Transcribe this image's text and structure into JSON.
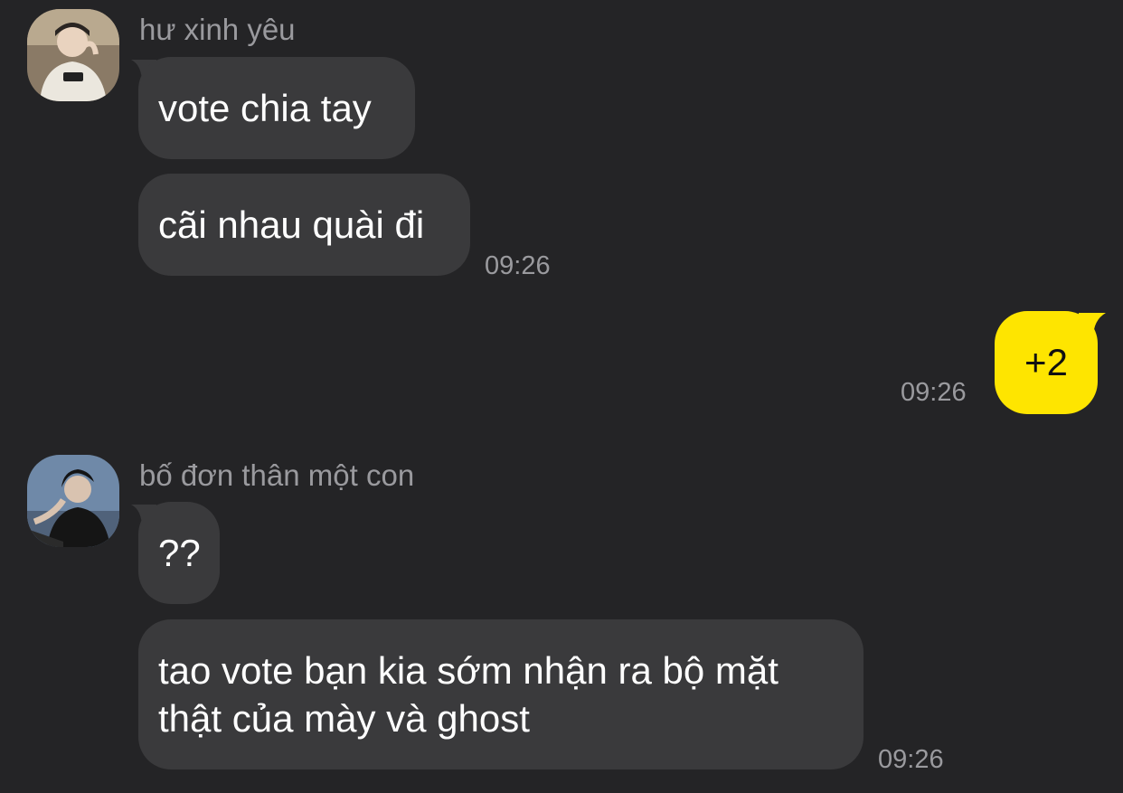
{
  "conversation": {
    "messages": [
      {
        "sender": "hư xinh yêu",
        "lines": [
          "vote chia tay",
          "cãi nhau quài đi"
        ],
        "time": "09:26"
      },
      {
        "sender": "me",
        "lines": [
          "+2"
        ],
        "time": "09:26"
      },
      {
        "sender": "bố đơn thân một con",
        "lines": [
          "??",
          "tao vote bạn kia sớm nhận ra bộ mặt thật của mày và ghost"
        ],
        "time": "09:26"
      }
    ]
  },
  "colors": {
    "background": "#242426",
    "incoming_bubble": "#3a3a3c",
    "outgoing_bubble": "#fee500",
    "meta_text": "#9a9a9e"
  }
}
